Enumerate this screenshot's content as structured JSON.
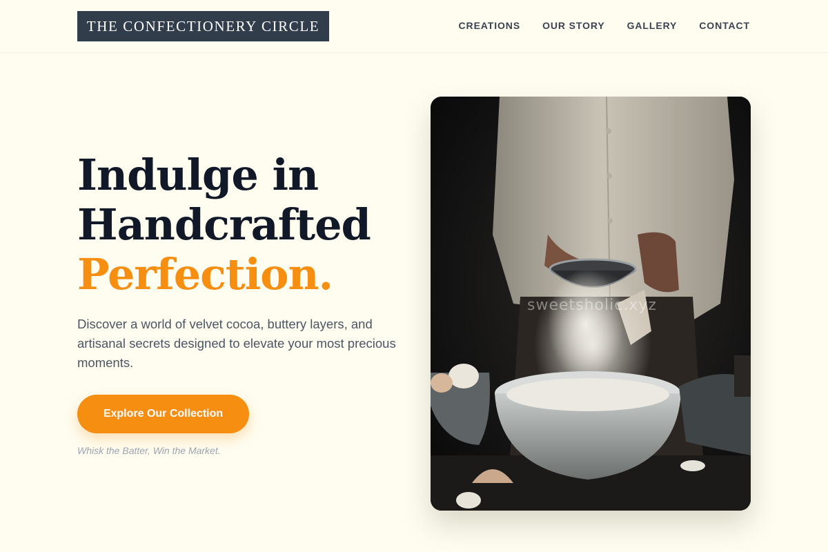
{
  "brand": {
    "name": "THE CONFECTIONERY CIRCLE"
  },
  "nav": {
    "items": [
      {
        "label": "CREATIONS"
      },
      {
        "label": "OUR STORY"
      },
      {
        "label": "GALLERY"
      },
      {
        "label": "CONTACT"
      }
    ]
  },
  "hero": {
    "headline_line1": "Indulge in",
    "headline_line2": "Handcrafted",
    "headline_accent": "Perfection.",
    "subtitle": "Discover a world of velvet cocoa, buttery layers, and artisanal secrets designed to elevate your most precious moments.",
    "cta_label": "Explore Our Collection",
    "tagline": "Whisk the Batter, Win the Market.",
    "image_watermark": "sweetsholic.xyz"
  },
  "colors": {
    "background": "#fefdf0",
    "brand_bar": "#323d4c",
    "accent": "#f68e12",
    "heading": "#111827",
    "body_text": "#4b5563",
    "muted_text": "#9ca3af"
  }
}
